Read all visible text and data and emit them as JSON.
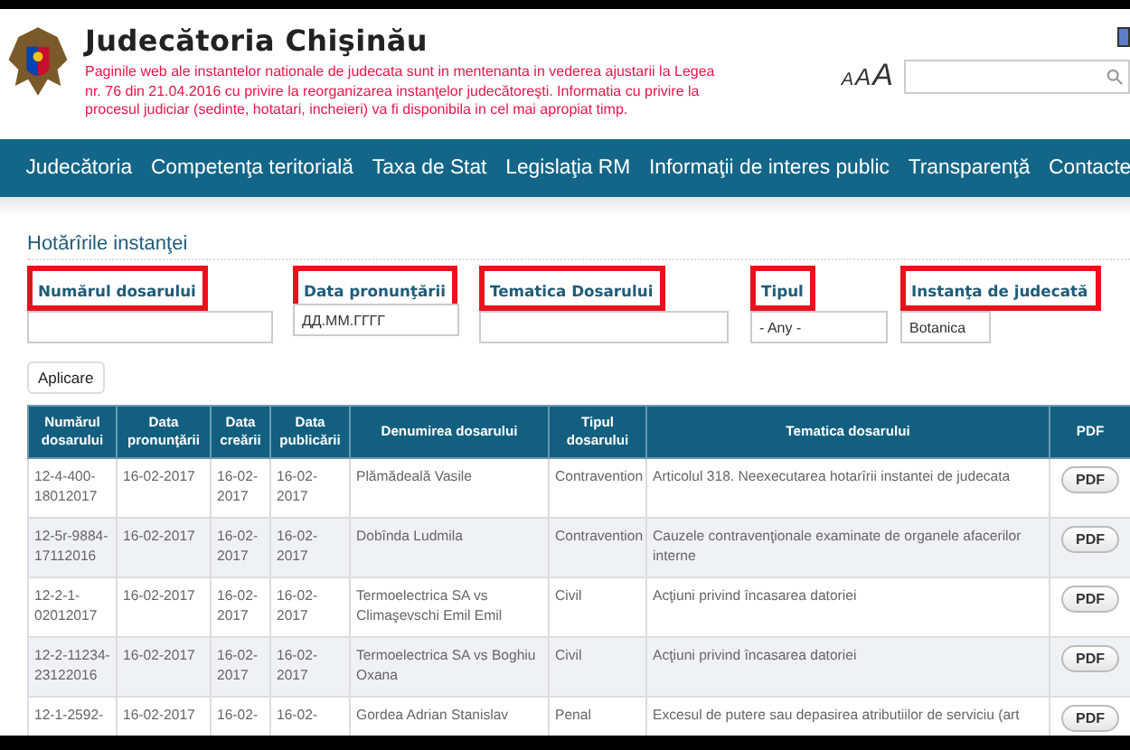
{
  "header": {
    "title": "Judecătoria Chişinău",
    "notice": "Paginile web ale instantelor nationale de judecata sunt in mentenanta in vederea ajustarii la Legea nr. 76 din 21.04.2016 cu privire la reorganizarea instanţelor judecătoreşti. Informatia cu privire la procesul judiciar (sedinte, hotatari, incheieri) va fi disponibila in cel mai apropiat timp.",
    "font_sizes": [
      "A",
      "A",
      "A"
    ]
  },
  "nav": [
    "Judecătoria",
    "Competenţa teritorială",
    "Taxa de Stat",
    "Legislaţia RM",
    "Informaţii de interes public",
    "Transparenţă",
    "Contacte"
  ],
  "page_title": "Hotărîrile instanţei",
  "filters": [
    {
      "kind": "text",
      "label": "Numărul dosarului",
      "highlighted": true
    },
    {
      "kind": "date",
      "label": "Data pronunţării",
      "placeholder": "ДД.ММ.ГГГГ",
      "highlighted": true
    },
    {
      "kind": "text",
      "label": "Tematica Dosarului",
      "highlighted": true
    },
    {
      "kind": "select",
      "label": "Tipul",
      "value": "- Any -",
      "highlighted": true
    },
    {
      "kind": "select",
      "label": "Instanţa de judecată",
      "value": "Botanica",
      "highlighted": true
    }
  ],
  "apply_button": "Aplicare",
  "table": {
    "columns": [
      "Numărul dosarului",
      "Data pronunţării",
      "Data creării",
      "Data publicării",
      "Denumirea dosarului",
      "Tipul dosarului",
      "Tematica dosarului",
      "PDF"
    ],
    "rows": [
      {
        "cells": [
          "12-4-400-18012017",
          "16-02-2017",
          "16-02-2017",
          "16-02-2017",
          "Plămădeală Vasile",
          "Contravention",
          "Articolul 318. Neexecutarea hotarîrii instantei de judecata"
        ],
        "button": "PDF"
      },
      {
        "cells": [
          "12-5r-9884-17112016",
          "16-02-2017",
          "16-02-2017",
          "16-02-2017",
          "Dobînda Ludmila",
          "Contravention",
          "Cauzele contravenţionale examinate de organele afacerilor interne"
        ],
        "button": "PDF"
      },
      {
        "cells": [
          "12-2-1-02012017",
          "16-02-2017",
          "16-02-2017",
          "16-02-2017",
          "Termoelectrica SA vs Climaşevschi Emil Emil",
          "Civil",
          "Acţiuni privind încasarea datoriei"
        ],
        "button": "PDF"
      },
      {
        "cells": [
          "12-2-11234-23122016",
          "16-02-2017",
          "16-02-2017",
          "16-02-2017",
          "Termoelectrica SA vs Boghiu Oxana",
          "Civil",
          "Acţiuni privind încasarea datoriei"
        ],
        "button": "PDF"
      },
      {
        "cells": [
          "12-1-2592-",
          "16-02-2017",
          "16-02-",
          "16-02-",
          "Gordea Adrian Stanislav",
          "Penal",
          "Excesul de putere sau depasirea atributiilor de serviciu (art"
        ],
        "button": "PDF"
      }
    ]
  }
}
